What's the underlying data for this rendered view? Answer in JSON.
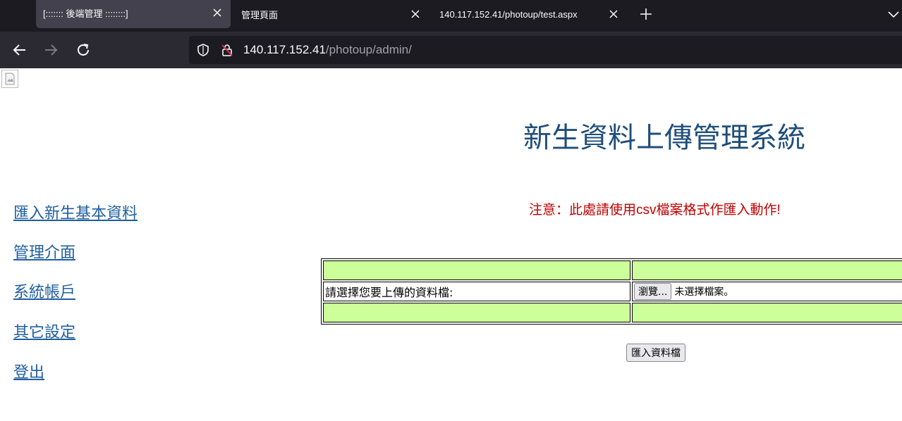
{
  "browser": {
    "tabs": [
      {
        "title": "[::::::: 後端管理 ::::::::]"
      },
      {
        "title": "管理頁面"
      },
      {
        "title": "140.117.152.41/photoup/test.aspx"
      }
    ],
    "url": {
      "host": "140.117.152.41",
      "path": "/photoup/admin/"
    }
  },
  "page": {
    "title": "新生資料上傳管理系統",
    "nav": [
      {
        "label": "匯入新生基本資料"
      },
      {
        "label": "管理介面"
      },
      {
        "label": "系統帳戶"
      },
      {
        "label": "其它設定"
      },
      {
        "label": "登出"
      }
    ],
    "notice": "注意：此處請使用csv檔案格式作匯入動作!",
    "upload": {
      "prompt": "請選擇您要上傳的資料檔:",
      "browse_label": "瀏覽...",
      "file_status": "未選擇檔案。"
    },
    "submit_label": "匯入資料檔"
  },
  "colors": {
    "title": "#1f4e79",
    "link": "#1f5f9f",
    "notice": "#c00000",
    "table_highlight": "#ccff99"
  }
}
